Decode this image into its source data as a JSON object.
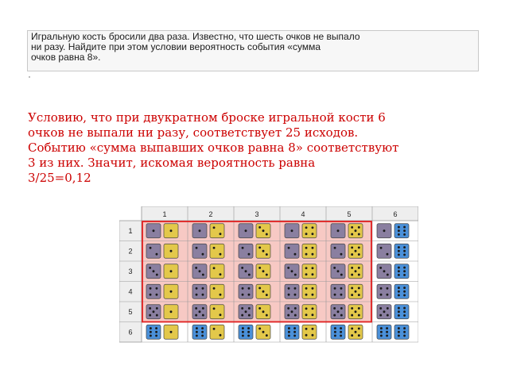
{
  "problem": {
    "text": "Игральную кость бросили два раза. Известно, что шесть очков не выпало\nни разу. Найдите при этом условии вероятность события «сумма\nочков равна 8»."
  },
  "answer": {
    "text": "Условию, что при двукратном броске игральной кости 6\nочков не выпали ни разу, соответствует 25 исходов.\nСобытию «сумма выпавших очков равна 8» соответствуют\n3 из них. Значит, искомая вероятность равна\n3/25=0,12"
  },
  "table": {
    "column_headers": [
      "1",
      "2",
      "3",
      "4",
      "5",
      "6"
    ],
    "row_headers": [
      "1",
      "2",
      "3",
      "4",
      "5",
      "6"
    ],
    "colors": {
      "first_die_normal": "#8a7fa0",
      "first_die_six": "#4a90d9",
      "second_die_normal": "#e3c84a",
      "second_die_six": "#4a90d9",
      "highlight_fill": "#f7c9c4",
      "highlight_border": "#e02020",
      "grid": "#999999",
      "header_bg": "#eeeeee"
    }
  }
}
